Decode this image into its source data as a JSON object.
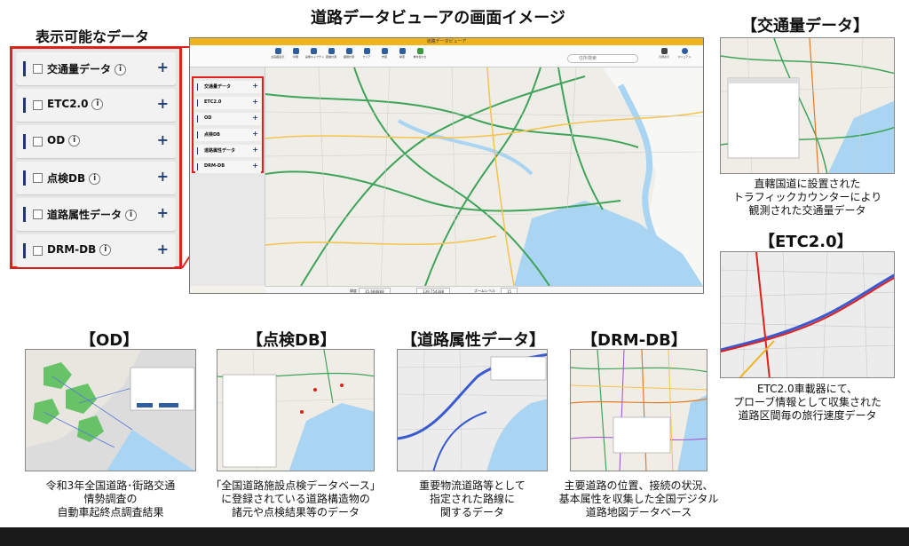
{
  "main_title": "道路データビューアの画面イメージ",
  "left_heading": "表示可能なデータ",
  "layers": [
    {
      "label": "交通量データ",
      "info": "i",
      "add": "+"
    },
    {
      "label": "ETC2.0",
      "info": "i",
      "add": "+"
    },
    {
      "label": "OD",
      "info": "i",
      "add": "+"
    },
    {
      "label": "点検DB",
      "info": "i",
      "add": "+"
    },
    {
      "label": "道路属性データ",
      "info": "i",
      "add": "+"
    },
    {
      "label": "DRM-DB",
      "info": "i",
      "add": "+"
    }
  ],
  "viewer": {
    "window_title": "道路データビューア",
    "search_placeholder": "住所検索",
    "status_lat": "35.688888",
    "status_lon": "139.754388",
    "zoom_label": "ズームレベル",
    "zoom_value": "15",
    "accent": "#f0b41c",
    "frame_color": "#e0201c"
  },
  "sections": {
    "traffic": {
      "title": "【交通量データ】",
      "caption": [
        "直轄国道に設置された",
        "トラフィックカウンターにより",
        "観測された交通量データ"
      ]
    },
    "etc": {
      "title": "【ETC2.0】",
      "caption": [
        "ETC2.0車載器にて、",
        "プローブ情報として収集された",
        "道路区間毎の旅行速度データ"
      ]
    },
    "od": {
      "title": "【OD】",
      "caption": [
        "令和3年全国道路･街路交通",
        "情勢調査の",
        "自動車起終点調査結果"
      ]
    },
    "inspection": {
      "title": "【点検DB】",
      "caption": [
        "「全国道路施設点検データベース」",
        "に登録されている道路構造物の",
        "諸元や点検結果等のデータ"
      ]
    },
    "attributes": {
      "title": "【道路属性データ】",
      "caption": [
        "重要物流道路等として",
        "指定された路線に",
        "関するデータ"
      ]
    },
    "drm": {
      "title": "【DRM-DB】",
      "caption": [
        "主要道路の位置、接続の状況、",
        "基本属性を収集した全国デジタル",
        "道路地図データベース"
      ]
    }
  }
}
